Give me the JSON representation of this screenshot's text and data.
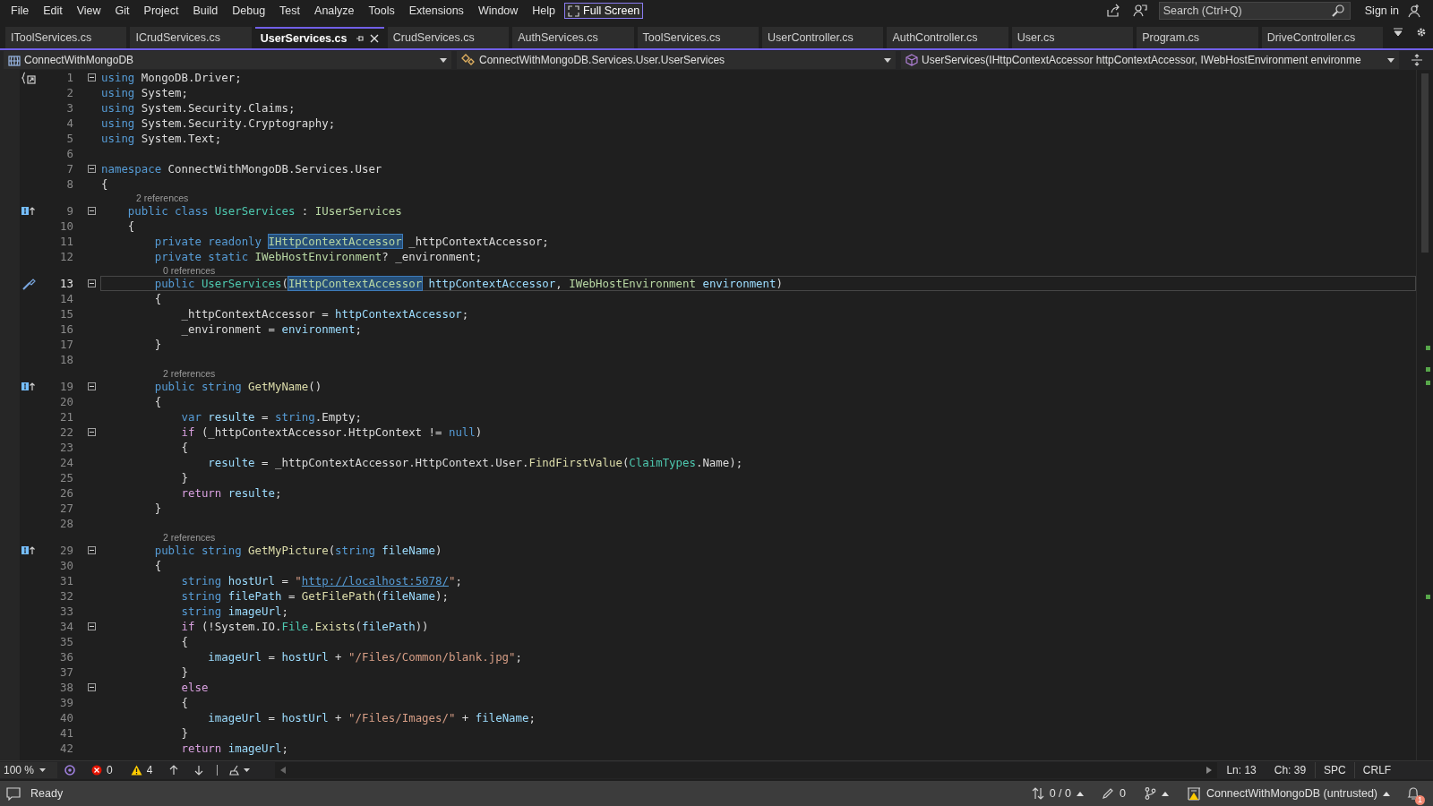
{
  "menu_bar": {
    "items": [
      "File",
      "Edit",
      "View",
      "Git",
      "Project",
      "Build",
      "Debug",
      "Test",
      "Analyze",
      "Tools",
      "Extensions",
      "Window",
      "Help"
    ],
    "full_screen": "Full Screen",
    "search": {
      "placeholder": "Search (Ctrl+Q)"
    },
    "sign_in": "Sign in"
  },
  "tabs": [
    {
      "label": "IToolServices.cs",
      "selected": false
    },
    {
      "label": "ICrudServices.cs",
      "selected": false
    },
    {
      "label": "UserServices.cs",
      "selected": true
    },
    {
      "label": "CrudServices.cs",
      "selected": false
    },
    {
      "label": "AuthServices.cs",
      "selected": false
    },
    {
      "label": "ToolServices.cs",
      "selected": false
    },
    {
      "label": "UserController.cs",
      "selected": false
    },
    {
      "label": "AuthController.cs",
      "selected": false
    },
    {
      "label": "User.cs",
      "selected": false
    },
    {
      "label": "Program.cs",
      "selected": false
    },
    {
      "label": "DriveController.cs",
      "selected": false
    }
  ],
  "navigation_bar": {
    "project": "ConnectWithMongoDB",
    "type": "ConnectWithMongoDB.Services.User.UserServices",
    "member": "UserServices(IHttpContextAccessor httpContextAccessor, IWebHostEnvironment environme"
  },
  "editor": {
    "lines": [
      {
        "number": "1",
        "folding": true,
        "current": false,
        "marker": {
          "kind": "scope"
        },
        "code": [
          {
            "kind": "keyword",
            "text": "using"
          },
          {
            "kind": "plain",
            "text": " MongoDB.Driver;"
          }
        ]
      },
      {
        "number": "2",
        "folding": false,
        "current": false,
        "code": [
          {
            "kind": "keyword",
            "text": "using"
          },
          {
            "kind": "plain",
            "text": " System;"
          }
        ]
      },
      {
        "number": "3",
        "folding": false,
        "current": false,
        "code": [
          {
            "kind": "keyword",
            "text": "using"
          },
          {
            "kind": "plain",
            "text": " System.Security.Claims;"
          }
        ]
      },
      {
        "number": "4",
        "folding": false,
        "current": false,
        "code": [
          {
            "kind": "keyword",
            "text": "using"
          },
          {
            "kind": "plain",
            "text": " System.Security.Cryptography;"
          }
        ]
      },
      {
        "number": "5",
        "folding": false,
        "current": false,
        "code": [
          {
            "kind": "keyword",
            "text": "using"
          },
          {
            "kind": "plain",
            "text": " System.Text;"
          }
        ]
      },
      {
        "number": "6",
        "folding": false,
        "current": false
      },
      {
        "number": "7",
        "folding": true,
        "current": false,
        "code": [
          {
            "kind": "keyword",
            "text": "namespace"
          },
          {
            "kind": "plain",
            "text": " ConnectWithMongoDB.Services.User"
          }
        ]
      },
      {
        "number": "8",
        "folding": false,
        "current": false,
        "code": [
          {
            "kind": "plain",
            "text": "{"
          }
        ]
      },
      {
        "number": "9",
        "folding": true,
        "current": false,
        "marker": {
          "kind": "implements"
        },
        "codelens": "2 references",
        "code": [
          {
            "kind": "keyword",
            "text": "    public"
          },
          {
            "kind": "keyword",
            "text": " class"
          },
          {
            "kind": "type",
            "text": " UserServices"
          },
          {
            "kind": "plain",
            "text": " : "
          },
          {
            "kind": "interface",
            "text": "IUserServices"
          }
        ]
      },
      {
        "number": "10",
        "folding": false,
        "current": false,
        "code": [
          {
            "kind": "plain",
            "text": "    {"
          }
        ]
      },
      {
        "number": "11",
        "folding": false,
        "current": false,
        "code": [
          {
            "kind": "keyword",
            "text": "        private"
          },
          {
            "kind": "keyword",
            "text": " readonly "
          },
          {
            "kind": "highlight",
            "text": "IHttpContextAccessor"
          },
          {
            "kind": "plain",
            "text": " _httpContextAccessor;"
          }
        ]
      },
      {
        "number": "12",
        "folding": false,
        "current": false,
        "code": [
          {
            "kind": "keyword",
            "text": "        private"
          },
          {
            "kind": "keyword",
            "text": " static"
          },
          {
            "kind": "interface",
            "text": " IWebHostEnvironment"
          },
          {
            "kind": "plain",
            "text": "? _environment;"
          }
        ]
      },
      {
        "number": "13",
        "folding": true,
        "current": true,
        "marker": {
          "kind": "action"
        },
        "codelens": "0 references",
        "code": [
          {
            "kind": "keyword",
            "text": "        public"
          },
          {
            "kind": "type",
            "text": " UserServices"
          },
          {
            "kind": "plain",
            "text": "("
          },
          {
            "kind": "highlight",
            "text": "IHttpContextAccessor"
          },
          {
            "kind": "variable",
            "text": " httpContextAccessor"
          },
          {
            "kind": "plain",
            "text": ", "
          },
          {
            "kind": "interface",
            "text": "IWebHostEnvironment"
          },
          {
            "kind": "variable",
            "text": " environment"
          },
          {
            "kind": "plain",
            "text": ")"
          }
        ]
      },
      {
        "number": "14",
        "folding": false,
        "current": false,
        "code": [
          {
            "kind": "plain",
            "text": "        {"
          }
        ]
      },
      {
        "number": "15",
        "folding": false,
        "current": false,
        "code": [
          {
            "kind": "plain",
            "text": "            _httpContextAccessor = "
          },
          {
            "kind": "variable",
            "text": "httpContextAccessor"
          },
          {
            "kind": "plain",
            "text": ";"
          }
        ]
      },
      {
        "number": "16",
        "folding": false,
        "current": false,
        "code": [
          {
            "kind": "plain",
            "text": "            _environment = "
          },
          {
            "kind": "variable",
            "text": "environment"
          },
          {
            "kind": "plain",
            "text": ";"
          }
        ]
      },
      {
        "number": "17",
        "folding": false,
        "current": false,
        "code": [
          {
            "kind": "plain",
            "text": "        }"
          }
        ]
      },
      {
        "number": "18",
        "folding": false,
        "current": false
      },
      {
        "number": "19",
        "folding": true,
        "current": false,
        "marker": {
          "kind": "implements"
        },
        "codelens": "2 references",
        "code": [
          {
            "kind": "keyword",
            "text": "        public"
          },
          {
            "kind": "keyword",
            "text": " string"
          },
          {
            "kind": "method",
            "text": " GetMyName"
          },
          {
            "kind": "plain",
            "text": "()"
          }
        ]
      },
      {
        "number": "20",
        "folding": false,
        "current": false,
        "code": [
          {
            "kind": "plain",
            "text": "        {"
          }
        ]
      },
      {
        "number": "21",
        "folding": false,
        "current": false,
        "code": [
          {
            "kind": "keyword",
            "text": "            var"
          },
          {
            "kind": "variable",
            "text": " resulte"
          },
          {
            "kind": "plain",
            "text": " = "
          },
          {
            "kind": "keyword",
            "text": "string"
          },
          {
            "kind": "plain",
            "text": ".Empty;"
          }
        ]
      },
      {
        "number": "22",
        "folding": true,
        "current": false,
        "code": [
          {
            "kind": "control",
            "text": "            if"
          },
          {
            "kind": "plain",
            "text": " (_httpContextAccessor.HttpContext != "
          },
          {
            "kind": "keyword",
            "text": "null"
          },
          {
            "kind": "plain",
            "text": ")"
          }
        ]
      },
      {
        "number": "23",
        "folding": false,
        "current": false,
        "code": [
          {
            "kind": "plain",
            "text": "            {"
          }
        ]
      },
      {
        "number": "24",
        "folding": false,
        "current": false,
        "code": [
          {
            "kind": "variable",
            "text": "                resulte"
          },
          {
            "kind": "plain",
            "text": " = _httpContextAccessor.HttpContext.User."
          },
          {
            "kind": "method",
            "text": "FindFirstValue"
          },
          {
            "kind": "plain",
            "text": "("
          },
          {
            "kind": "type",
            "text": "ClaimTypes"
          },
          {
            "kind": "plain",
            "text": ".Name);"
          }
        ]
      },
      {
        "number": "25",
        "folding": false,
        "current": false,
        "code": [
          {
            "kind": "plain",
            "text": "            }"
          }
        ]
      },
      {
        "number": "26",
        "folding": false,
        "current": false,
        "code": [
          {
            "kind": "control",
            "text": "            return"
          },
          {
            "kind": "variable",
            "text": " resulte"
          },
          {
            "kind": "plain",
            "text": ";"
          }
        ]
      },
      {
        "number": "27",
        "folding": false,
        "current": false,
        "code": [
          {
            "kind": "plain",
            "text": "        }"
          }
        ]
      },
      {
        "number": "28",
        "folding": false,
        "current": false
      },
      {
        "number": "29",
        "folding": true,
        "current": false,
        "marker": {
          "kind": "implements"
        },
        "codelens": "2 references",
        "code": [
          {
            "kind": "keyword",
            "text": "        public"
          },
          {
            "kind": "keyword",
            "text": " string"
          },
          {
            "kind": "method",
            "text": " GetMyPicture"
          },
          {
            "kind": "plain",
            "text": "("
          },
          {
            "kind": "keyword",
            "text": "string"
          },
          {
            "kind": "variable",
            "text": " fileName"
          },
          {
            "kind": "plain",
            "text": ")"
          }
        ]
      },
      {
        "number": "30",
        "folding": false,
        "current": false,
        "code": [
          {
            "kind": "plain",
            "text": "        {"
          }
        ]
      },
      {
        "number": "31",
        "folding": false,
        "current": false,
        "code": [
          {
            "kind": "keyword",
            "text": "            string"
          },
          {
            "kind": "variable",
            "text": " hostUrl"
          },
          {
            "kind": "plain",
            "text": " = "
          },
          {
            "kind": "string",
            "text": "\""
          },
          {
            "kind": "link",
            "text": "http://localhost:5078/"
          },
          {
            "kind": "string",
            "text": "\""
          },
          {
            "kind": "plain",
            "text": ";"
          }
        ]
      },
      {
        "number": "32",
        "folding": false,
        "current": false,
        "code": [
          {
            "kind": "keyword",
            "text": "            string"
          },
          {
            "kind": "variable",
            "text": " filePath"
          },
          {
            "kind": "plain",
            "text": " = "
          },
          {
            "kind": "method",
            "text": "GetFilePath"
          },
          {
            "kind": "plain",
            "text": "("
          },
          {
            "kind": "variable",
            "text": "fileName"
          },
          {
            "kind": "plain",
            "text": ");"
          }
        ]
      },
      {
        "number": "33",
        "folding": false,
        "current": false,
        "code": [
          {
            "kind": "keyword",
            "text": "            string"
          },
          {
            "kind": "variable",
            "text": " imageUrl"
          },
          {
            "kind": "plain",
            "text": ";"
          }
        ]
      },
      {
        "number": "34",
        "folding": true,
        "current": false,
        "code": [
          {
            "kind": "control",
            "text": "            if"
          },
          {
            "kind": "plain",
            "text": " (!System.IO."
          },
          {
            "kind": "type",
            "text": "File"
          },
          {
            "kind": "plain",
            "text": "."
          },
          {
            "kind": "method",
            "text": "Exists"
          },
          {
            "kind": "plain",
            "text": "("
          },
          {
            "kind": "variable",
            "text": "filePath"
          },
          {
            "kind": "plain",
            "text": "))"
          }
        ]
      },
      {
        "number": "35",
        "folding": false,
        "current": false,
        "code": [
          {
            "kind": "plain",
            "text": "            {"
          }
        ]
      },
      {
        "number": "36",
        "folding": false,
        "current": false,
        "code": [
          {
            "kind": "variable",
            "text": "                imageUrl"
          },
          {
            "kind": "plain",
            "text": " = "
          },
          {
            "kind": "variable",
            "text": "hostUrl"
          },
          {
            "kind": "plain",
            "text": " + "
          },
          {
            "kind": "string",
            "text": "\"/Files/Common/blank.jpg\""
          },
          {
            "kind": "plain",
            "text": ";"
          }
        ]
      },
      {
        "number": "37",
        "folding": false,
        "current": false,
        "code": [
          {
            "kind": "plain",
            "text": "            }"
          }
        ]
      },
      {
        "number": "38",
        "folding": true,
        "current": false,
        "code": [
          {
            "kind": "control",
            "text": "            else"
          }
        ]
      },
      {
        "number": "39",
        "folding": false,
        "current": false,
        "code": [
          {
            "kind": "plain",
            "text": "            {"
          }
        ]
      },
      {
        "number": "40",
        "folding": false,
        "current": false,
        "code": [
          {
            "kind": "variable",
            "text": "                imageUrl"
          },
          {
            "kind": "plain",
            "text": " = "
          },
          {
            "kind": "variable",
            "text": "hostUrl"
          },
          {
            "kind": "plain",
            "text": " + "
          },
          {
            "kind": "string",
            "text": "\"/Files/Images/\""
          },
          {
            "kind": "plain",
            "text": " + "
          },
          {
            "kind": "variable",
            "text": "fileName"
          },
          {
            "kind": "plain",
            "text": ";"
          }
        ]
      },
      {
        "number": "41",
        "folding": false,
        "current": false,
        "code": [
          {
            "kind": "plain",
            "text": "            }"
          }
        ]
      },
      {
        "number": "42",
        "folding": false,
        "current": false,
        "code": [
          {
            "kind": "control",
            "text": "            return"
          },
          {
            "kind": "variable",
            "text": " imageUrl"
          },
          {
            "kind": "plain",
            "text": ";"
          }
        ]
      }
    ]
  },
  "editor_status": {
    "zoom": "100 %",
    "errors": "0",
    "warnings": "4",
    "line": "Ln: 13",
    "column": "Ch: 39",
    "indent": "SPC",
    "line_ending": "CRLF"
  },
  "status_bar": {
    "status": "Ready",
    "sync": "0 / 0",
    "changes": "0",
    "repository": "ConnectWithMongoDB (untrusted)",
    "notifications": "1"
  }
}
